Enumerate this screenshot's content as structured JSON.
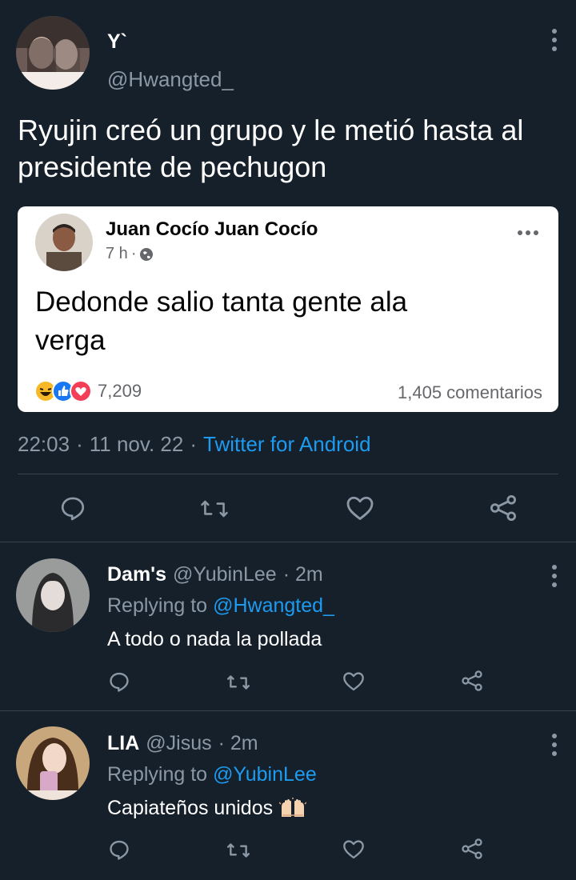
{
  "main_tweet": {
    "display_name": "Y`",
    "handle": "@Hwangted_",
    "text_line1": "Ryujin creó un grupo y le metió hasta al",
    "text_line2": "presidente de pechugon",
    "time": "22:03",
    "date": "11 nov. 22",
    "sep": "·",
    "source": "Twitter for Android",
    "actions": [
      "reply-icon",
      "retweet-icon",
      "like-icon",
      "share-icon"
    ]
  },
  "embedded_post": {
    "author": "Juan Cocío Juan Cocío",
    "time": "7 h",
    "dot": "·",
    "text_line1": "Dedonde salio tanta gente ala",
    "text_line2": "verga",
    "reaction_count": "7,209",
    "comments": "1,405 comentarios"
  },
  "replies": [
    {
      "display_name": "Dam's",
      "handle": "@YubinLee",
      "time": "· 2m",
      "replying_prefix": "Replying to",
      "replying_to": "@Hwangted_",
      "text": "A todo o nada la pollada"
    },
    {
      "display_name": "LIA",
      "handle": "@Jisus",
      "time": "· 2m",
      "replying_prefix": "Replying to",
      "replying_to": "@YubinLee",
      "text": "Capiateños unidos"
    }
  ],
  "colors": {
    "background": "#15202b",
    "secondary_text": "#8b98a5",
    "link": "#1d9bf0",
    "divider": "#38444d"
  }
}
